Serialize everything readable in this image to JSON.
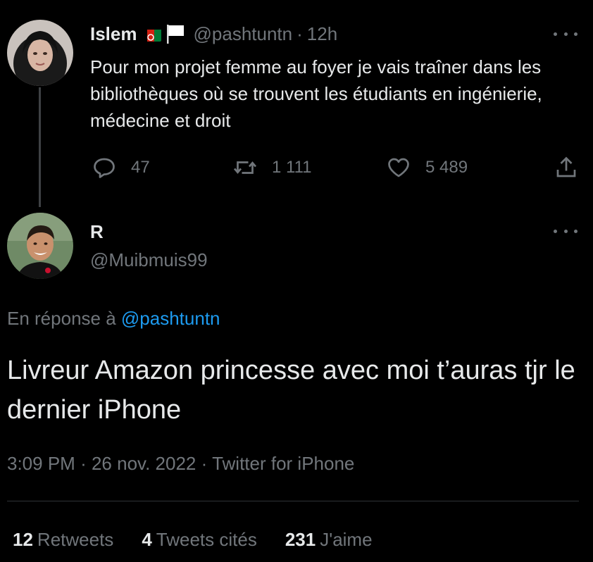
{
  "original_tweet": {
    "author_name": "Islem",
    "flags": [
      "afghanistan-flag-icon",
      "white-flag-icon"
    ],
    "handle": "@pashtuntn",
    "separator": "·",
    "time": "12h",
    "text": "Pour mon projet femme au foyer je vais traîner dans les bibliothèques où se trouvent les étudiants en ingénierie, médecine et droit",
    "actions": {
      "replies": "47",
      "retweets": "1 111",
      "likes": "5 489"
    }
  },
  "reply_tweet": {
    "author_name": "R",
    "handle": "@Muibmuis99",
    "reply_prefix": "En réponse à",
    "reply_to": "@pashtuntn",
    "text": "Livreur Amazon princesse avec moi t’auras tjr le dernier iPhone",
    "time": "3:09 PM",
    "date": "26 nov. 2022",
    "source": "Twitter for iPhone",
    "meta_separator": "·"
  },
  "stats": {
    "retweets_count": "12",
    "retweets_label": "Retweets",
    "quotes_count": "4",
    "quotes_label": "Tweets cités",
    "likes_count": "231",
    "likes_label": "J'aime"
  },
  "colors": {
    "background": "#000000",
    "text": "#e7e9ea",
    "muted": "#71767b",
    "link": "#1d9bf0",
    "divider": "#2f3336"
  }
}
